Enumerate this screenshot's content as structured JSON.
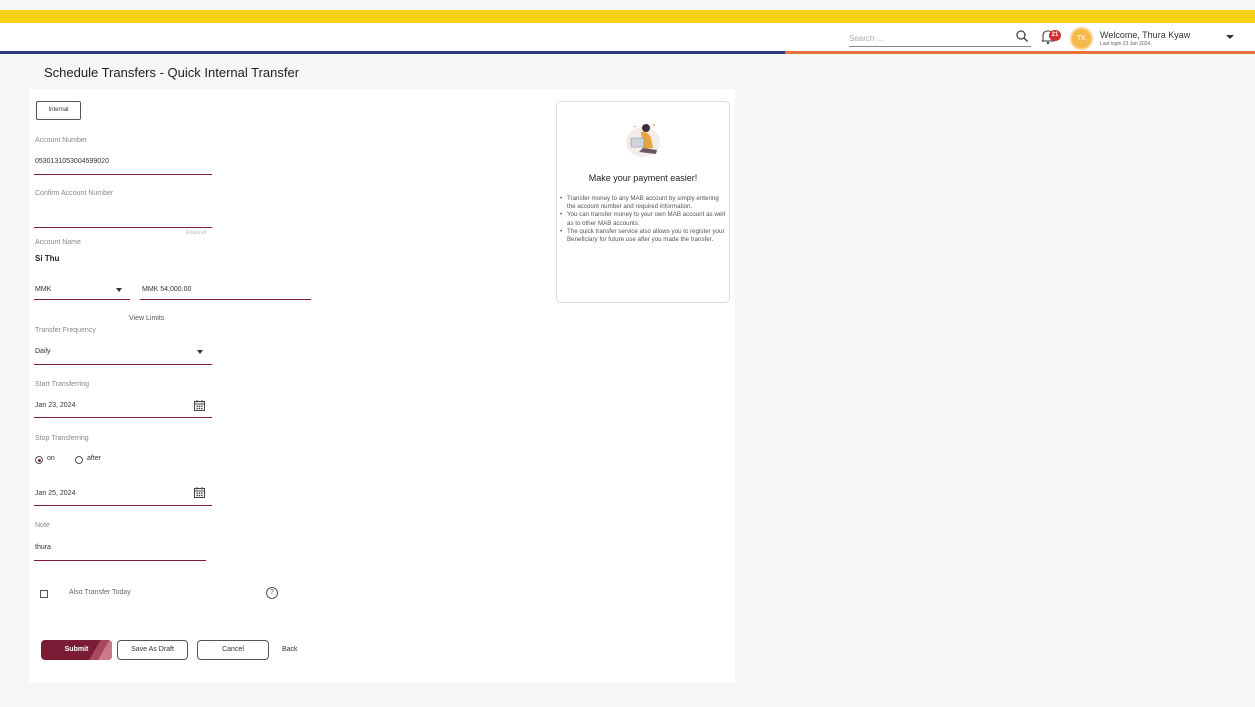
{
  "header": {
    "search_placeholder": "Search ...",
    "notification_count": "21",
    "avatar_initials": "TK",
    "welcome": "Welcome, Thura Kyaw",
    "last_login": "Last login 23 Jan 2024,"
  },
  "page": {
    "title": "Schedule Transfers - Quick Internal Transfer"
  },
  "form": {
    "tab_internal": "Internal",
    "account_number_label": "Account Number",
    "account_number": "0530131053004599020",
    "confirm_account_label": "Confirm Account Number",
    "confirm_account_value": "",
    "required_hint": "Required",
    "account_name_label": "Account Name",
    "account_name": "Si Thu",
    "currency": "MMK",
    "amount": "MMK 54,000.00",
    "view_limits": "View Limits",
    "frequency_label": "Transfer Frequency",
    "frequency": "Daily",
    "start_label": "Start Transferring",
    "start_date": "Jan 23, 2024",
    "stop_label": "Stop Transferring",
    "stop_on": "on",
    "stop_after": "after",
    "stop_date": "Jan 25, 2024",
    "note_label": "Note",
    "note": "thura",
    "also_today": "Also Transfer Today",
    "help_glyph": "?"
  },
  "buttons": {
    "submit": "Submit",
    "save_draft": "Save As Draft",
    "cancel": "Cancel",
    "back": "Back"
  },
  "promo": {
    "title": "Make your payment easier!",
    "bullets": [
      "Transfer money to any MAB account by simply entering the account number and required information.",
      "You can transfer money to your own MAB account as well as to other MAB accounts.",
      "The quick transfer service also allows you to register your Beneficiary for future use after you made the transfer."
    ]
  },
  "colors": {
    "brand_primary": "#7a1c35",
    "top_bar": "#f7d117",
    "header_line_left": "#2b3a84",
    "header_line_right": "#e8733a",
    "badge": "#d32f2f"
  }
}
